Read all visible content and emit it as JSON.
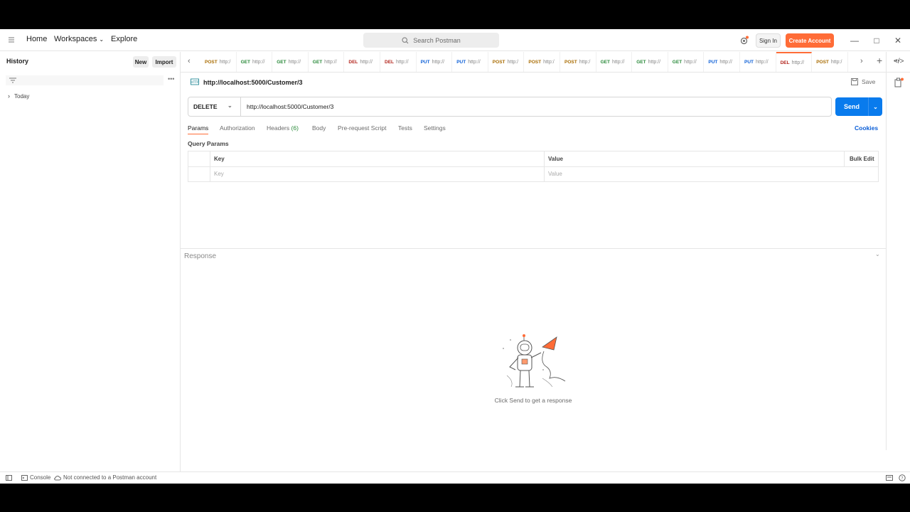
{
  "header": {
    "nav": [
      "Home",
      "Workspaces",
      "Explore"
    ],
    "search_placeholder": "Search Postman",
    "sign_in": "Sign In",
    "create_account": "Create Account",
    "accent": "#ff6c37"
  },
  "sidebar": {
    "title": "History",
    "new_label": "New",
    "import_label": "Import",
    "group_label": "Today"
  },
  "tabs": [
    {
      "method": "POST",
      "url": "http:/"
    },
    {
      "method": "GET",
      "url": "http://"
    },
    {
      "method": "GET",
      "url": "http://"
    },
    {
      "method": "GET",
      "url": "http://"
    },
    {
      "method": "DEL",
      "url": "http://"
    },
    {
      "method": "DEL",
      "url": "http://"
    },
    {
      "method": "PUT",
      "url": "http://"
    },
    {
      "method": "PUT",
      "url": "http://"
    },
    {
      "method": "POST",
      "url": "http:/"
    },
    {
      "method": "POST",
      "url": "http:/"
    },
    {
      "method": "POST",
      "url": "http:/"
    },
    {
      "method": "GET",
      "url": "http://"
    },
    {
      "method": "GET",
      "url": "http://"
    },
    {
      "method": "GET",
      "url": "http://"
    },
    {
      "method": "PUT",
      "url": "http://"
    },
    {
      "method": "PUT",
      "url": "http://"
    },
    {
      "method": "DEL",
      "url": "http://"
    },
    {
      "method": "POST",
      "url": "http:/"
    }
  ],
  "request": {
    "title": "http://localhost:5000/Customer/3",
    "save_label": "Save",
    "method": "DELETE",
    "url": "http://localhost:5000/Customer/3",
    "send_label": "Send",
    "cookies_label": "Cookies",
    "tabs": [
      "Params",
      "Authorization",
      "Headers",
      "(6)",
      "Body",
      "Pre-request Script",
      "Tests",
      "Settings"
    ],
    "query_params_label": "Query Params",
    "table": {
      "key_header": "Key",
      "value_header": "Value",
      "bulk_edit": "Bulk Edit",
      "key_placeholder": "Key",
      "value_placeholder": "Value"
    }
  },
  "response": {
    "label": "Response",
    "empty_text": "Click Send to get a response"
  },
  "footer": {
    "console": "Console",
    "status": "Not connected to a Postman account"
  }
}
